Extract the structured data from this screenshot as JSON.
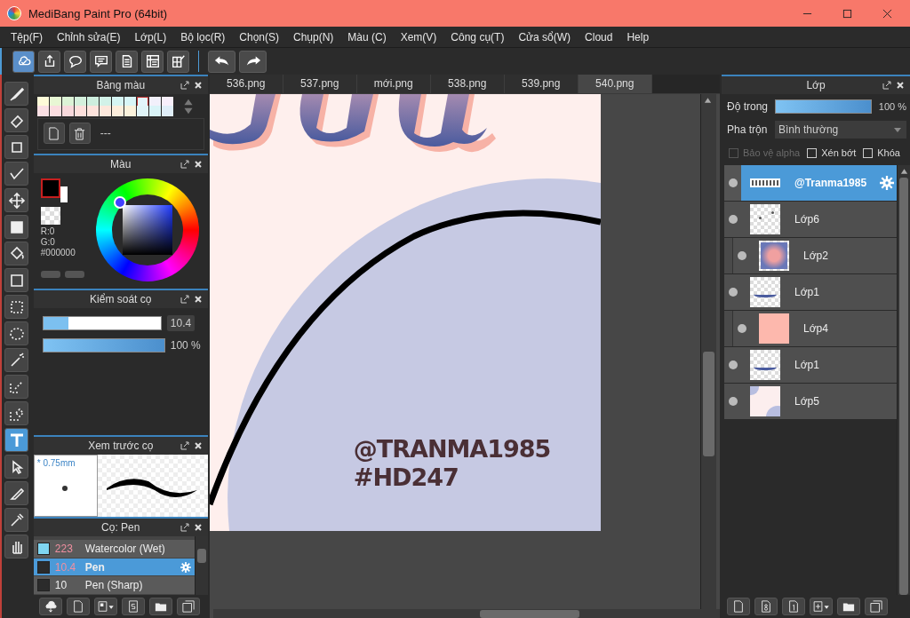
{
  "window": {
    "title": "MediBang Paint Pro (64bit)"
  },
  "menu": [
    "Tệp(F)",
    "Chỉnh sửa(E)",
    "Lớp(L)",
    "Bộ lọc(R)",
    "Chọn(S)",
    "Chụp(N)",
    "Màu (C)",
    "Xem(V)",
    "Công cụ(T)",
    "Cửa sổ(W)",
    "Cloud",
    "Help"
  ],
  "toolbar": [
    {
      "kind": "cloud",
      "selected": true
    },
    {
      "kind": "share",
      "selected": false
    },
    {
      "kind": "bubble",
      "selected": false
    },
    {
      "kind": "comment",
      "selected": false
    },
    {
      "kind": "document",
      "selected": false
    },
    {
      "kind": "list",
      "selected": false
    },
    {
      "kind": "grid",
      "selected": false
    }
  ],
  "tools": [
    {
      "kind": "brush",
      "selected": false
    },
    {
      "kind": "eraser",
      "selected": false
    },
    {
      "kind": "shape",
      "selected": false
    },
    {
      "kind": "polyline",
      "selected": false
    },
    {
      "kind": "move",
      "selected": false
    },
    {
      "kind": "fill",
      "selected": false
    },
    {
      "kind": "bucket",
      "selected": false
    },
    {
      "kind": "gradient",
      "selected": false
    },
    {
      "kind": "select",
      "selected": false
    },
    {
      "kind": "lasso",
      "selected": false
    },
    {
      "kind": "wand",
      "selected": false
    },
    {
      "kind": "selectpen",
      "selected": false
    },
    {
      "kind": "selecteraser",
      "selected": false
    },
    {
      "kind": "text",
      "selected": true
    },
    {
      "kind": "operation",
      "selected": false
    },
    {
      "kind": "knife",
      "selected": false
    },
    {
      "kind": "dropper",
      "selected": false
    },
    {
      "kind": "hand",
      "selected": false
    }
  ],
  "palette_panel": {
    "title": "Bảng màu",
    "label": "---",
    "swatches": [
      {
        "color": "#fefbd8",
        "selected": false
      },
      {
        "color": "#e8f7d4",
        "selected": false
      },
      {
        "color": "#dcf3d6",
        "selected": false
      },
      {
        "color": "#d4f0dc",
        "selected": false
      },
      {
        "color": "#cdeede",
        "selected": false
      },
      {
        "color": "#d2f2e8",
        "selected": false
      },
      {
        "color": "#d5f5f3",
        "selected": false
      },
      {
        "color": "#d8f6f8",
        "selected": false
      },
      {
        "color": "#e3f5fb",
        "selected": true
      },
      {
        "color": "#f2f0fb",
        "selected": false
      },
      {
        "color": "#f8effb",
        "selected": false
      },
      {
        "color": "#fbe0e4",
        "selected": false
      },
      {
        "color": "#fbdde0",
        "selected": false
      },
      {
        "color": "#f8d9dc",
        "selected": false
      },
      {
        "color": "#fde0dc",
        "selected": false
      },
      {
        "color": "#fde3dc",
        "selected": false
      },
      {
        "color": "#fde8dc",
        "selected": false
      },
      {
        "color": "#fdeedc",
        "selected": false
      },
      {
        "color": "#fbf2dc",
        "selected": false
      },
      {
        "color": "#e0f4f8",
        "selected": false
      },
      {
        "color": "#daf4f8",
        "selected": false
      },
      {
        "color": "#e0eef8",
        "selected": false
      }
    ]
  },
  "color_panel": {
    "title": "Màu",
    "readouts": [
      "R:0",
      "G:0",
      "#000000"
    ]
  },
  "brush_control": {
    "title": "Kiểm soát cọ",
    "size": {
      "level": 0.21,
      "reading": "10.4"
    },
    "opacity": {
      "level": 1,
      "reading": "100 %"
    }
  },
  "brush_preview": {
    "title": "Xem trước cọ",
    "size_label": "* 0.75mm"
  },
  "brush_list": {
    "title": "Cọ: Pen",
    "items": [
      {
        "size": "223",
        "name": "Watercolor (Wet)",
        "color": "#7fd6f2",
        "selected": false
      },
      {
        "size": "10.4",
        "name": "Pen",
        "color": "#2b2b2b",
        "selected": true
      },
      {
        "size": "10",
        "name": "Pen (Sharp)",
        "color": "#2b2b2b",
        "selected": false
      }
    ]
  },
  "tabs": [
    {
      "label": "536.png",
      "selected": false
    },
    {
      "label": "537.png",
      "selected": false
    },
    {
      "label": "mới.png",
      "selected": false
    },
    {
      "label": "538.png",
      "selected": false
    },
    {
      "label": "539.png",
      "selected": false
    },
    {
      "label": "540.png",
      "selected": true
    }
  ],
  "canvas": {
    "texts": [
      "@TRANMA1985",
      "#HD247"
    ]
  },
  "layers_panel": {
    "title": "Lớp",
    "opacity_label": "Độ trong",
    "opacity": {
      "level": 1,
      "reading": "100 %"
    },
    "blend_label": "Pha trộn",
    "blend_value": "Bình thường",
    "checkboxes": [
      {
        "label": "Bảo vệ alpha",
        "checked": false,
        "disabled": true
      },
      {
        "label": "Xén bớt",
        "checked": false,
        "disabled": false
      },
      {
        "label": "Khóa",
        "checked": false,
        "disabled": false
      }
    ],
    "layers": [
      {
        "name": "@Tranma1985",
        "kind": "text",
        "clipped": false,
        "selected": true
      },
      {
        "name": "Lớp6",
        "kind": "dots",
        "clipped": false,
        "selected": false
      },
      {
        "name": "Lớp2",
        "kind": "blur",
        "clipped": true,
        "selected": false
      },
      {
        "name": "Lớp1",
        "kind": "script",
        "clipped": false,
        "selected": false
      },
      {
        "name": "Lớp4",
        "kind": "solid",
        "clipped": true,
        "selected": false
      },
      {
        "name": "Lớp1",
        "kind": "script",
        "clipped": false,
        "selected": false
      },
      {
        "name": "Lớp5",
        "kind": "shapes",
        "clipped": false,
        "selected": false
      }
    ]
  }
}
